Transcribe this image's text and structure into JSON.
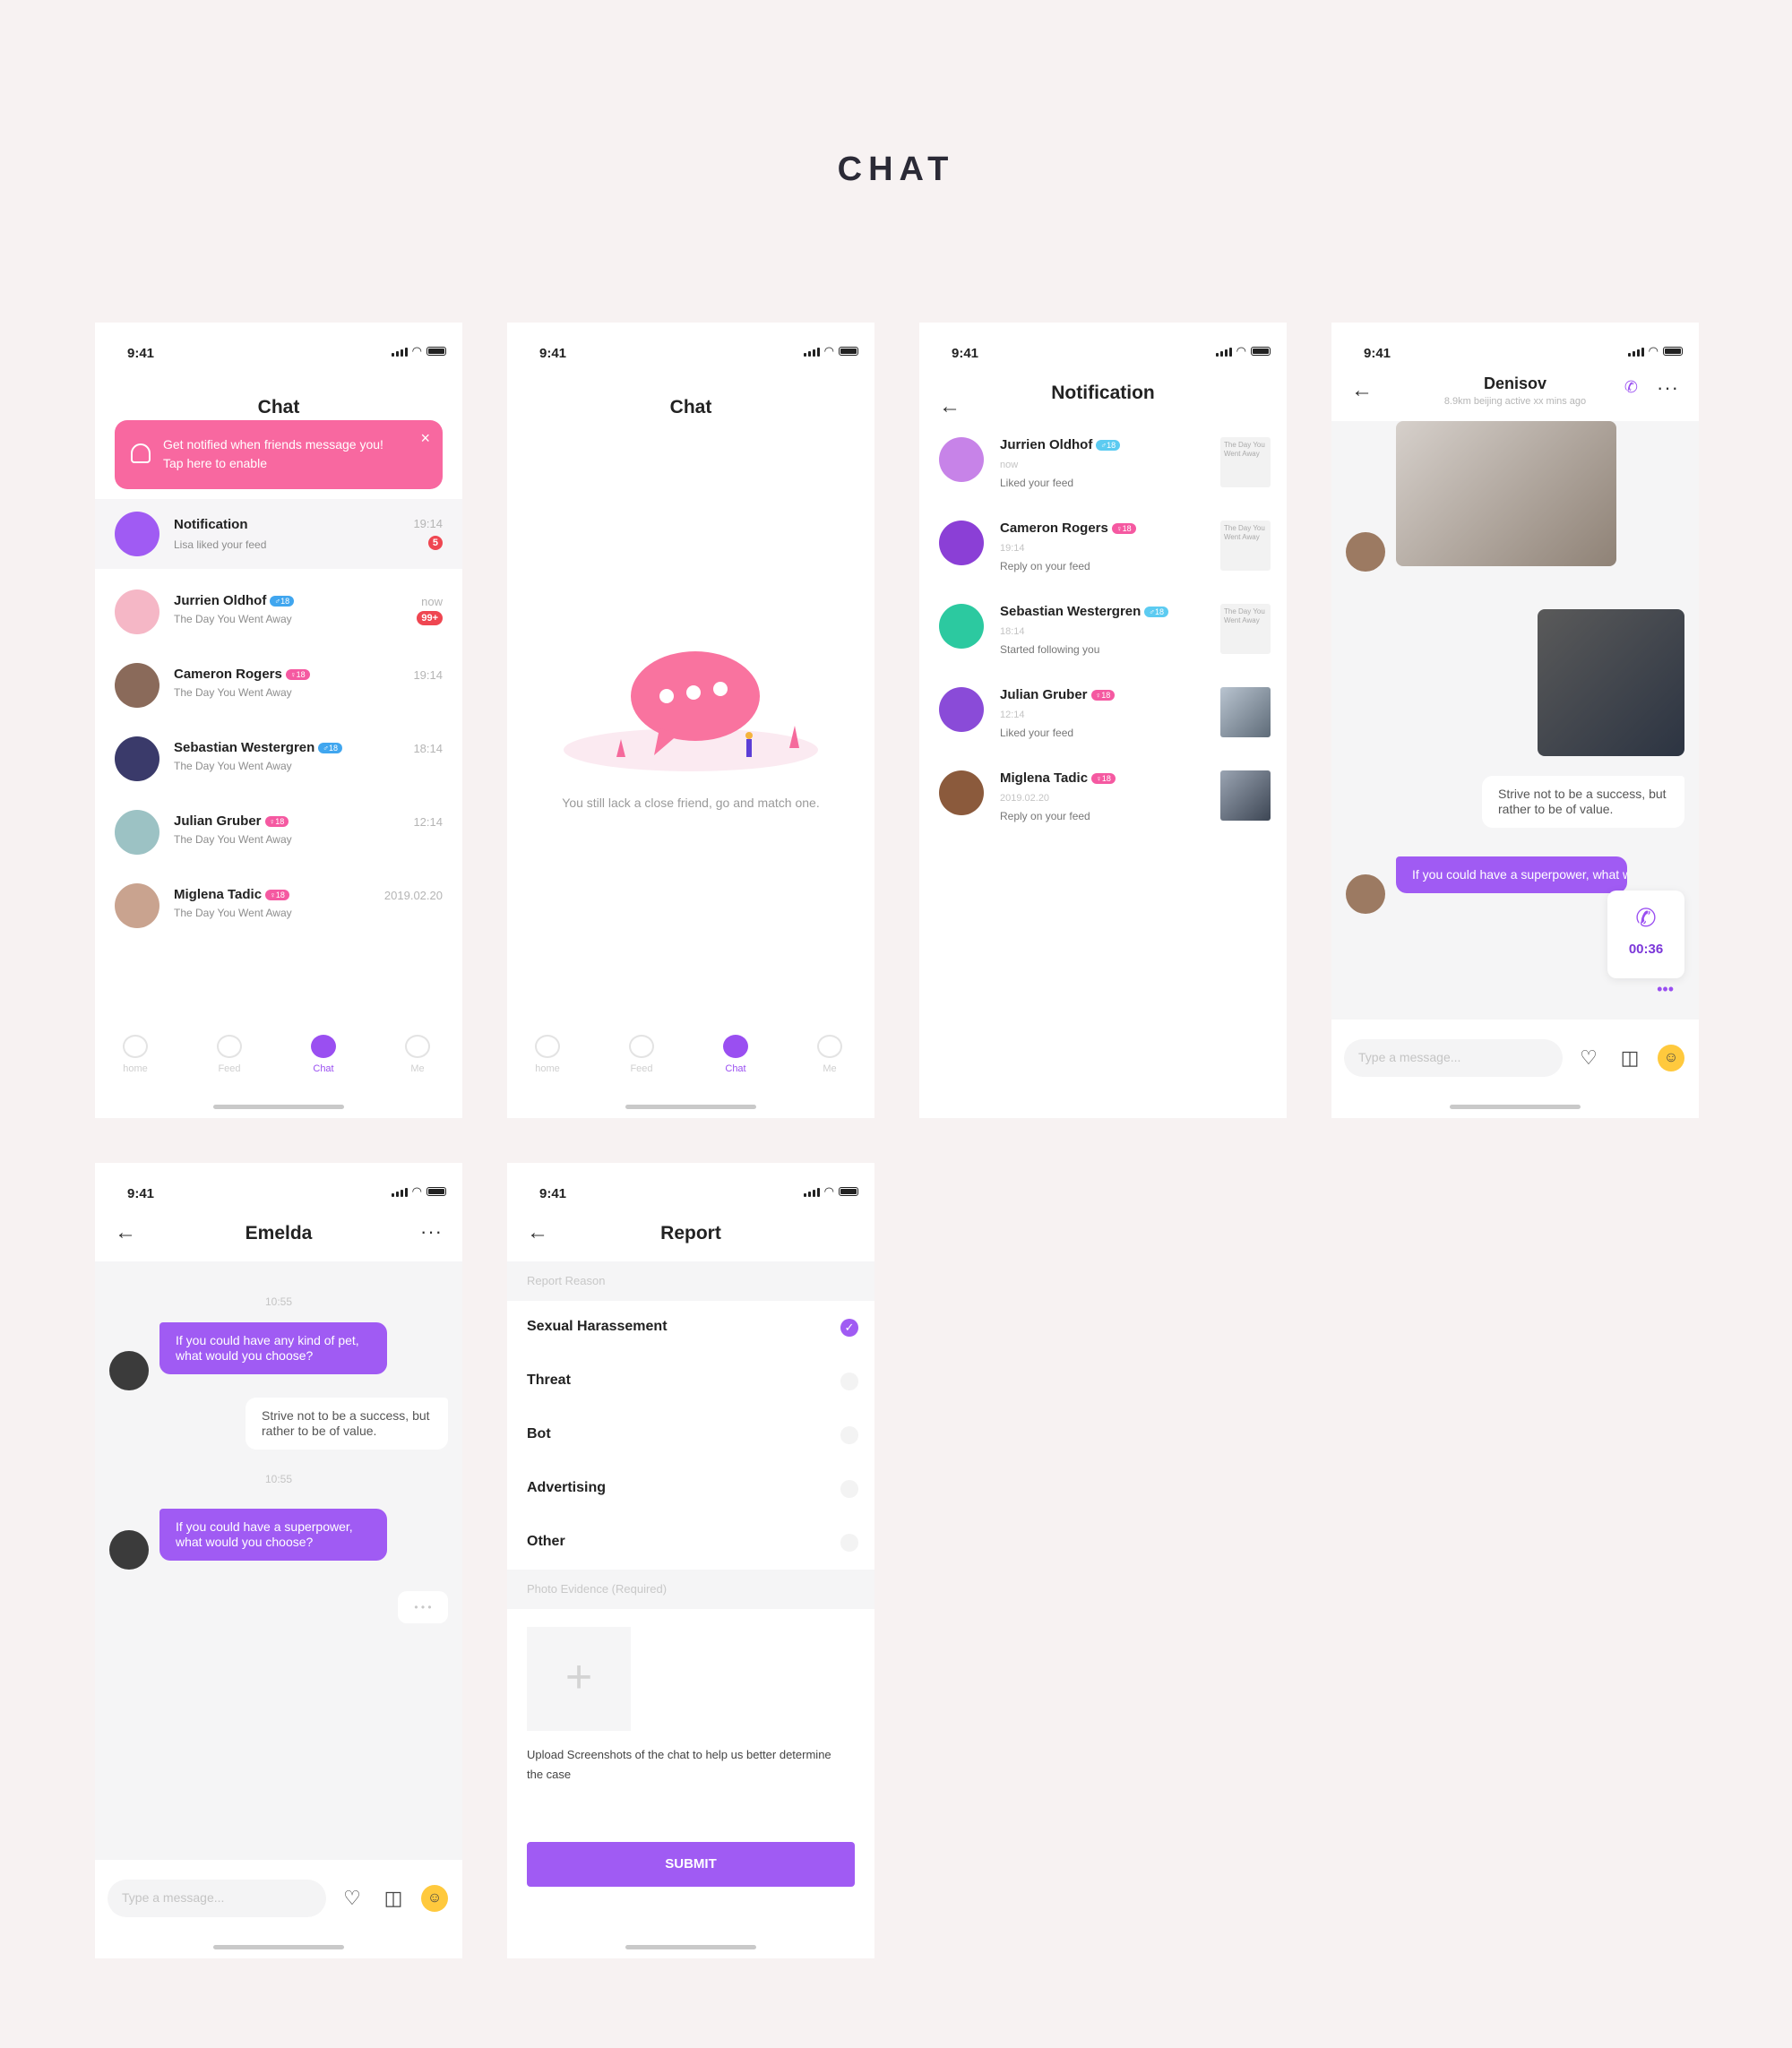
{
  "page": {
    "title": "CHAT"
  },
  "status": {
    "time": "9:41"
  },
  "chat_list": {
    "title": "Chat",
    "banner": {
      "line1": "Get notified when friends message you!",
      "line2": "Tap here to enable",
      "close": "×"
    },
    "notification": {
      "name": "Notification",
      "sub": "Lisa liked your feed",
      "time": "19:14",
      "count": "5"
    },
    "rows": [
      {
        "name": "Jurrien Oldhof",
        "tag": "♂18",
        "tag_type": "m",
        "sub": "The Day You Went Away",
        "time": "now",
        "count": "99+",
        "color": "#f5b7c6"
      },
      {
        "name": "Cameron Rogers",
        "tag": "♀18",
        "tag_type": "f",
        "sub": "The Day You Went Away",
        "time": "19:14",
        "color": "#8a6a5a"
      },
      {
        "name": "Sebastian Westergren",
        "tag": "♂18",
        "tag_type": "m",
        "sub": "The Day You Went Away",
        "time": "18:14",
        "color": "#3a3a6a"
      },
      {
        "name": "Julian Gruber",
        "tag": "♀18",
        "tag_type": "f",
        "sub": "The Day You Went Away",
        "time": "12:14",
        "color": "#9cc2c4"
      },
      {
        "name": "Miglena Tadic",
        "tag": "♀18",
        "tag_type": "f",
        "sub": "The Day You Went Away",
        "time": "2019.02.20",
        "color": "#c9a38f"
      }
    ]
  },
  "tabs": [
    "home",
    "Feed",
    "Chat",
    "Me"
  ],
  "empty_chat": {
    "title": "Chat",
    "text": "You still lack a close friend, go and match one."
  },
  "notifications": {
    "title": "Notification",
    "rows": [
      {
        "name": "Jurrien Oldhof",
        "tag": "♂18",
        "tag_type": "c",
        "time": "now",
        "action": "Liked your feed",
        "thumb": "The Day You Went Away",
        "color": "#c783e8"
      },
      {
        "name": "Cameron Rogers",
        "tag": "♀18",
        "tag_type": "f",
        "time": "19:14",
        "action": "Reply on your feed",
        "thumb": "The Day You Went Away",
        "color": "#8b3fd6"
      },
      {
        "name": "Sebastian Westergren",
        "tag": "♂18",
        "tag_type": "c",
        "time": "18:14",
        "action": "Started following you",
        "thumb": "The Day You Went Away",
        "color": "#2cc9a0"
      },
      {
        "name": "Julian Gruber",
        "tag": "♀18",
        "tag_type": "f",
        "time": "12:14",
        "action": "Liked your feed",
        "thumb": "",
        "color": "#8a4bd8"
      },
      {
        "name": "Miglena Tadic",
        "tag": "♀18",
        "tag_type": "f",
        "time": "2019.02.20",
        "action": "Reply on your feed",
        "thumb": "",
        "color": "#8b5a3c"
      }
    ]
  },
  "denisov": {
    "name": "Denisov",
    "meta": "8.9km  beijing  active xx mins ago",
    "white_msg": "Strive not to be a success, but rather to be of value.",
    "purple_msg": "If you could have a superpower, what would you choose?",
    "call_duration": "00:36",
    "input_placeholder": "Type a message..."
  },
  "emelda": {
    "name": "Emelda",
    "ts1": "10:55",
    "msg1": "If you could have any kind of pet, what would you choose?",
    "msg2": "Strive not to be a success, but rather to be of value.",
    "ts2": "10:55",
    "msg3": "If you could have a superpower, what would you choose?",
    "typing": "• • •",
    "input_placeholder": "Type a message..."
  },
  "report": {
    "title": "Report",
    "reason_header": "Report Reason",
    "options": [
      "Sexual Harassement",
      "Threat",
      "Bot",
      "Advertising",
      "Other"
    ],
    "selected": "Sexual Harassement",
    "evidence_header": "Photo Evidence (Required)",
    "hint": "Upload Screenshots of the chat to help us better determine the case",
    "submit": "SUBMIT"
  }
}
